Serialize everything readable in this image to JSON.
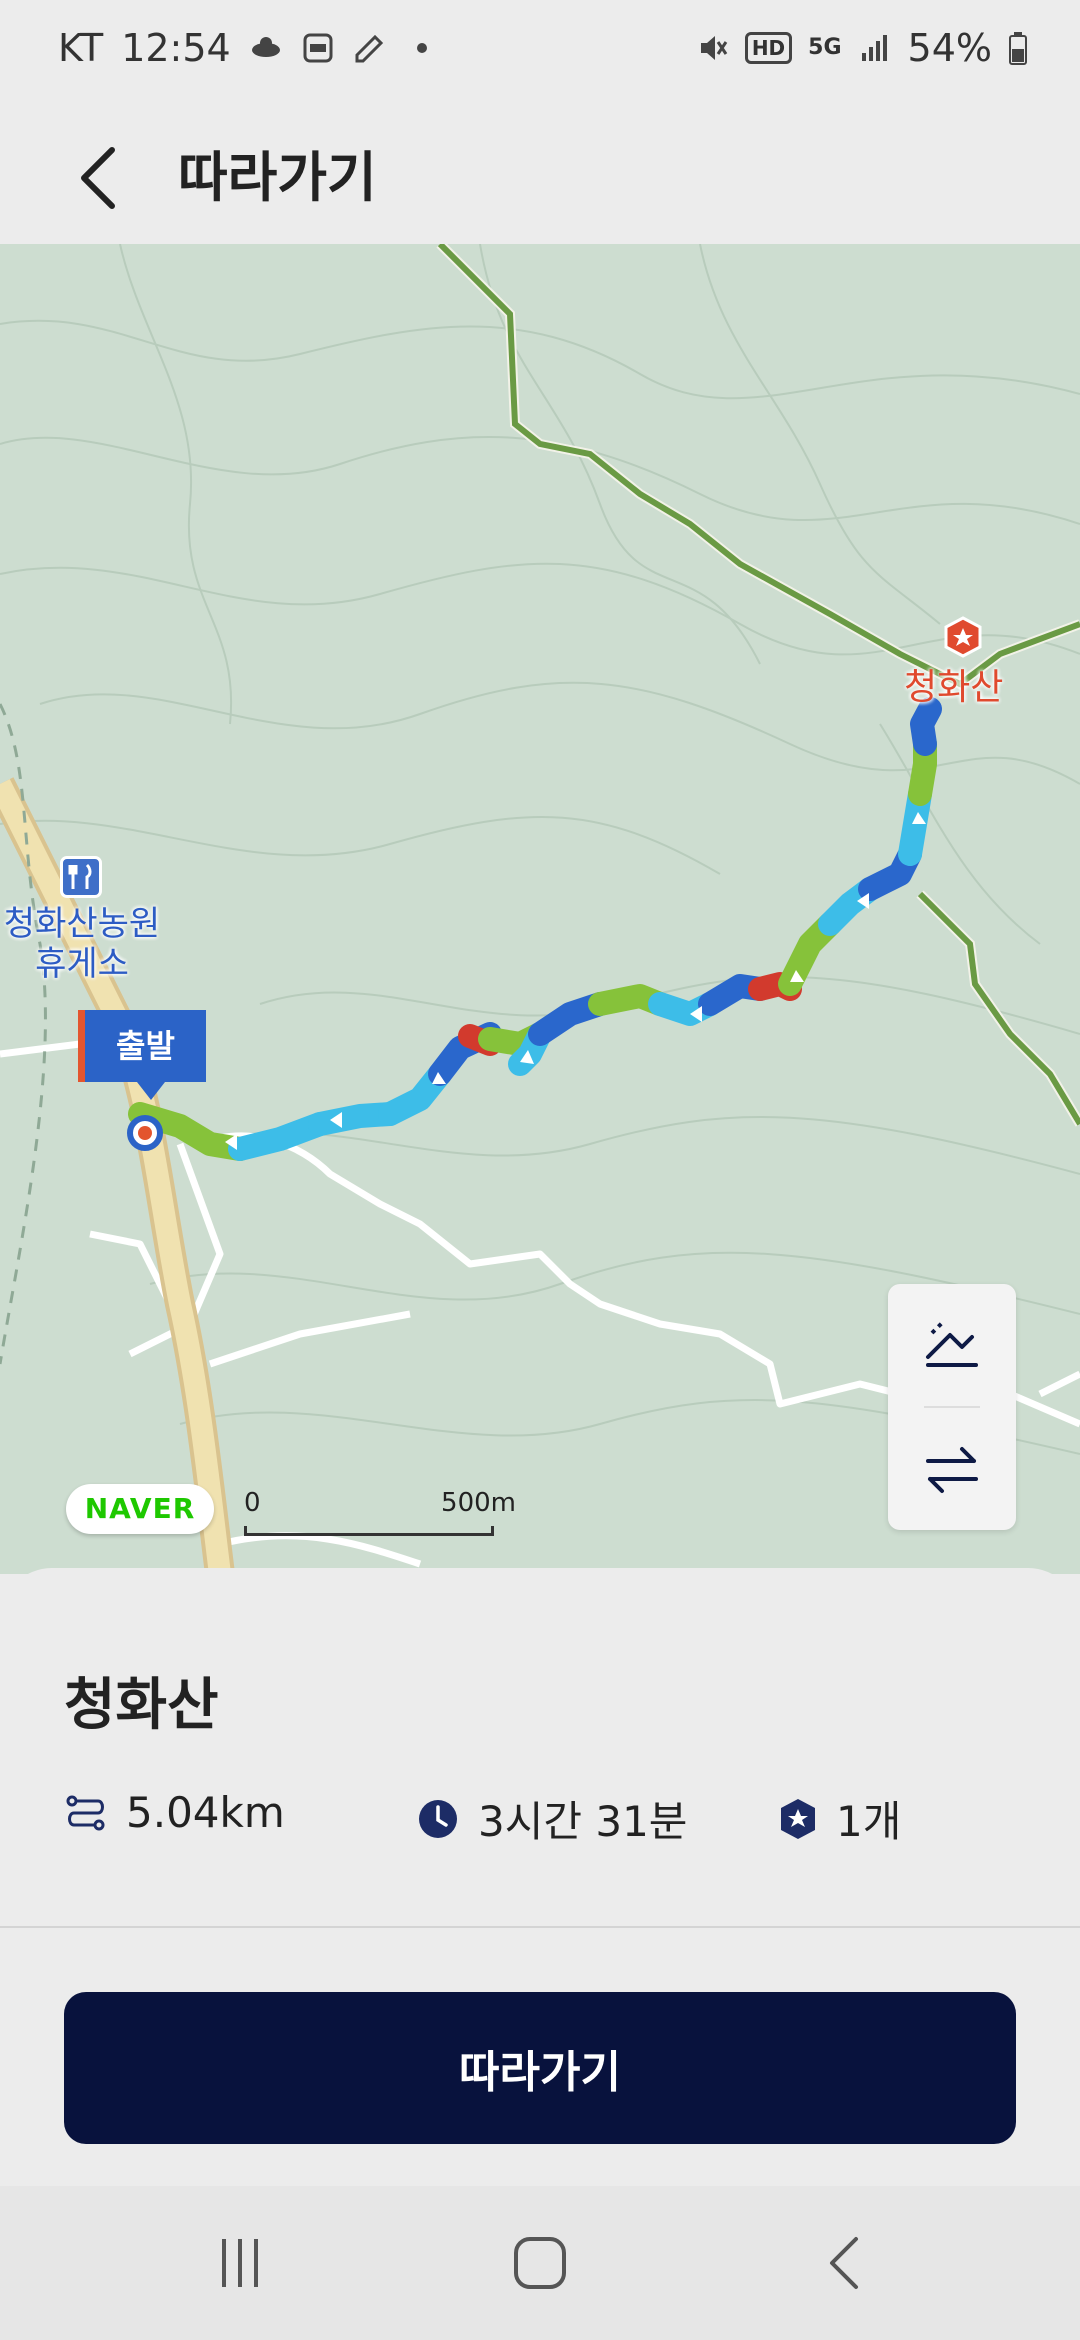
{
  "status_bar": {
    "carrier": "KT",
    "time": "12:54",
    "hd": "HD",
    "network": "5G",
    "battery": "54%"
  },
  "header": {
    "title": "따라가기"
  },
  "map": {
    "rest_area_label": "청화산농원\n휴게소",
    "peak_label": "청화산",
    "start_flag": "출발",
    "naver_logo": "NAVER",
    "scale_zero": "0",
    "scale_distance": "500m",
    "controls": [
      "elevation-toggle",
      "reverse-direction"
    ]
  },
  "course": {
    "name": "청화산",
    "distance": "5.04km",
    "duration": "3시간 31분",
    "peak_count": "1개"
  },
  "action": {
    "follow_label": "따라가기"
  },
  "colors": {
    "primary_button": "#08123d",
    "map_bg": "#cdddd0",
    "trail_light_blue": "#3dbde8",
    "trail_blue": "#2a67cc",
    "trail_green": "#86c23a",
    "trail_red": "#d23a2d",
    "main_road": "#6a9a44"
  },
  "icons": {
    "distance": "route-icon",
    "time": "clock-icon",
    "peaks": "peak-badge-icon"
  }
}
